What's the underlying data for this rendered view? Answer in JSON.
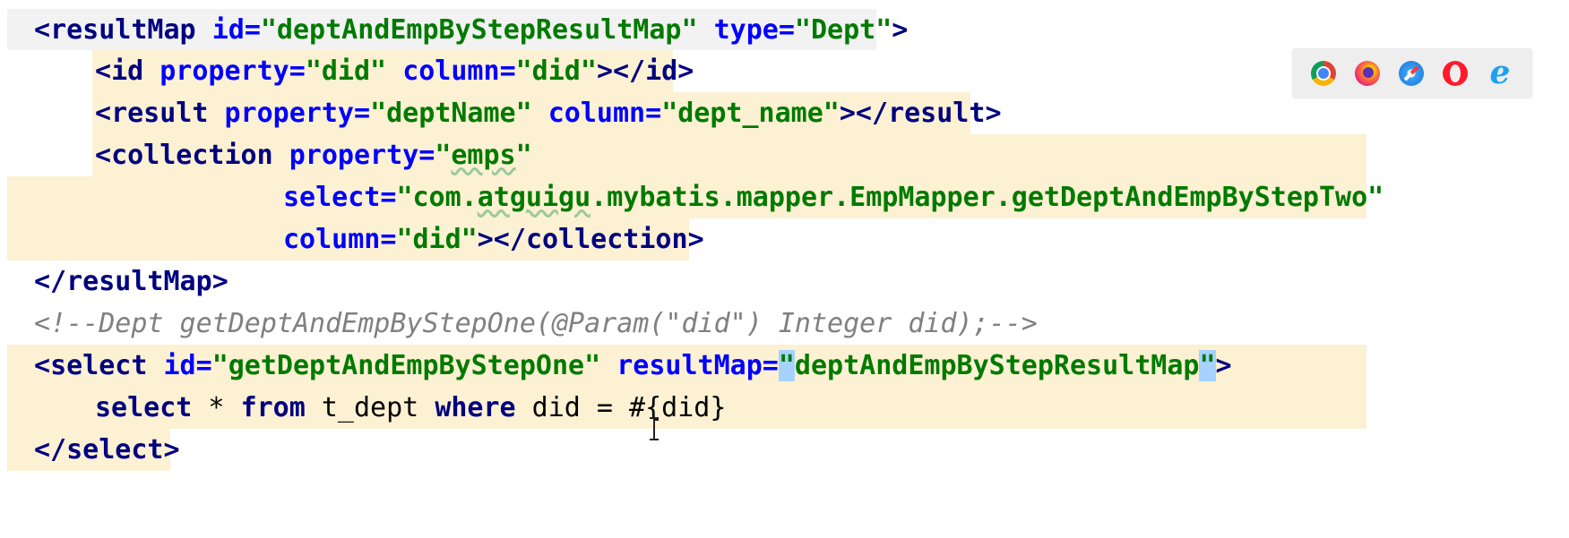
{
  "code": {
    "line1": {
      "open": "<",
      "tag": "resultMap",
      "attr1": "id",
      "eq1": "=",
      "val1": "\"deptAndEmpByStepResultMap\"",
      "attr2": "type",
      "eq2": "=",
      "val2": "\"Dept\"",
      "close": ">"
    },
    "line2": {
      "open": "<",
      "tag": "id",
      "attr1": "property",
      "eq1": "=",
      "val1": "\"did\"",
      "attr2": "column",
      "eq2": "=",
      "val2": "\"did\"",
      "close": "></",
      "tag2": "id",
      "end": ">"
    },
    "line3": {
      "open": "<",
      "tag": "result",
      "attr1": "property",
      "eq1": "=",
      "val1": "\"deptName\"",
      "attr2": "column",
      "eq2": "=",
      "val2": "\"dept_name\"",
      "close": "></",
      "tag2": "result",
      "end": ">"
    },
    "line4": {
      "open": "<",
      "tag": "collection",
      "attr1": "property",
      "eq1": "=",
      "val1a": "\"",
      "val1b": "emps",
      "val1c": "\""
    },
    "line5": {
      "attr": "select",
      "eq": "=",
      "val_a": "\"com.",
      "val_b": "atguigu",
      "val_c": ".mybatis.mapper.EmpMapper.getDeptAndEmpByStepTwo\""
    },
    "line6": {
      "attr": "column",
      "eq": "=",
      "val": "\"did\"",
      "close": "></",
      "tag": "collection",
      "end": ">"
    },
    "line7": {
      "open": "</",
      "tag": "resultMap",
      "close": ">"
    },
    "line8": {
      "comment": "<!--Dept getDeptAndEmpByStepOne(@Param(\"did\") Integer did);-->"
    },
    "line9": {
      "open": "<",
      "tag": "select",
      "attr1": "id",
      "eq1": "=",
      "val1": "\"getDeptAndEmpByStepOne\"",
      "attr2": "resultMap",
      "eq2": "=",
      "q1": "\"",
      "val2": "deptAndEmpByStepResultMap",
      "q2": "\"",
      "close": ">"
    },
    "line10": {
      "kw1": "select",
      "star": " * ",
      "kw2": "from",
      "t1": " t_dept ",
      "kw3": "where",
      "t2": " did = #{did}"
    },
    "line11": {
      "open": "</",
      "tag": "select",
      "close": ">"
    }
  },
  "browser_icons": [
    "chrome-icon",
    "firefox-icon",
    "safari-icon",
    "opera-icon",
    "ie-icon"
  ],
  "ie_glyph": "e"
}
